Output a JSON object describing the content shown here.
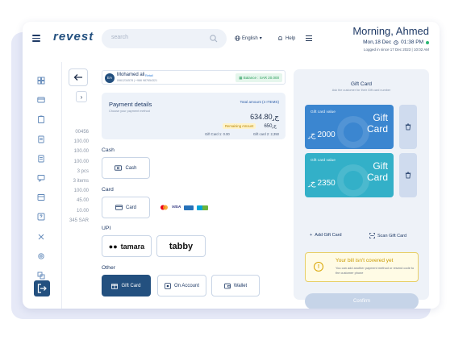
{
  "header": {
    "logo": "revest",
    "search_placeholder": "search",
    "language": "English",
    "help": "Help",
    "greeting_prefix": "Morning,",
    "greeting_name": "Ahmed",
    "date": "Mon,18 Dec",
    "time": "01:38 PM",
    "logged_in": "Logged in since 17 Dec 2023 | 10:02 AM"
  },
  "sidebar": {
    "icons": [
      "grid-icon",
      "card-icon",
      "clipboard-icon",
      "document-icon",
      "document-icon",
      "chat-icon",
      "box-icon",
      "help-icon",
      "tools-icon",
      "settings-icon",
      "layers-icon",
      "logout-icon"
    ]
  },
  "behind_list": [
    "00456",
    "100.00",
    "100.00",
    "100.00",
    "3 pcs",
    "3 items",
    "100.00",
    "45.00",
    "10.00",
    "345 SAR"
  ],
  "customer": {
    "initials": "EA",
    "name": "Mohamed ali",
    "tag": "Retail",
    "phone": "0961234578 | +966 987654321",
    "balance": "Balance : SAR 20.000"
  },
  "payment": {
    "title": "Payment details",
    "subtitle": "Choose your payment method",
    "total_label": "Total amount (4 ITEMS)",
    "total": "634.80",
    "remaining_label": "Remaining Amount",
    "remaining": "650",
    "gift_card_1": "Gift Card 1: 0.00",
    "gift_card_2": "Gift card 2: 2,350"
  },
  "methods": {
    "cash_label": "Cash",
    "cash": "Cash",
    "card_label": "Card",
    "card": "Card",
    "card_brands": [
      "VISA"
    ],
    "upi_label": "UPI",
    "tamara": "tamara",
    "tabby": "tabby",
    "other_label": "Other",
    "gift_card": "Gift Card",
    "on_account": "On Account",
    "wallet": "Wallet"
  },
  "gift_panel": {
    "title": "Gift Card",
    "subtitle": "Ask the customer for their Gift card number",
    "cards": [
      {
        "label": "Gift card value",
        "big": "Gift Card",
        "value": "2000",
        "color": "#3b86d0"
      },
      {
        "label": "Gift card value",
        "big": "Gift Card",
        "value": "2350",
        "color": "#33b0c8"
      }
    ],
    "add": "Add Gift Card",
    "scan": "Scan Gift Card",
    "warning_title": "Your bill isn't covered yet",
    "warning_text": "You can add another payment method or resend code to the customer phone",
    "confirm": "Confirm"
  }
}
